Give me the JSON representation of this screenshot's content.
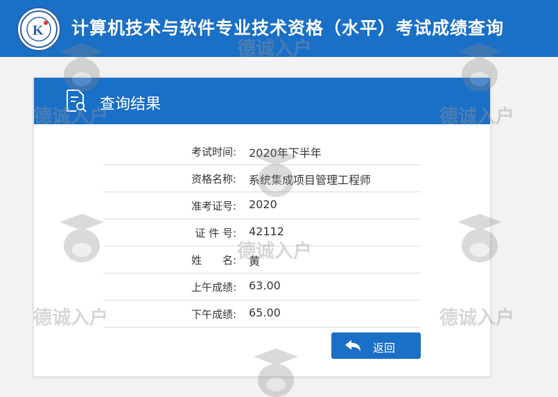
{
  "header": {
    "title": "计算机技术与软件专业技术资格（水平）考试成绩查询"
  },
  "card": {
    "title": "查询结果"
  },
  "result": {
    "rows": [
      {
        "label": "考试时间:",
        "value": "2020年下半年"
      },
      {
        "label": "资格名称:",
        "value": "系统集成项目管理工程师"
      },
      {
        "label": "准考证号:",
        "value": "2020"
      },
      {
        "label": "证 件 号:",
        "value": "42112"
      },
      {
        "label": "姓　　名:",
        "value": "黄"
      },
      {
        "label": "上午成绩:",
        "value": "63.00"
      },
      {
        "label": "下午成绩:",
        "value": "65.00"
      }
    ]
  },
  "actions": {
    "back_label": "返回"
  },
  "watermark": {
    "text": "德诚入户"
  },
  "colors": {
    "primary": "#1a6fc7",
    "background": "#f2f2f2",
    "card": "#ffffff",
    "text": "#333333"
  },
  "icons": {
    "logo": "exam-logo-icon",
    "document": "document-search-icon",
    "back": "back-arrow-icon",
    "mascot": "mascot-watermark-icon"
  }
}
